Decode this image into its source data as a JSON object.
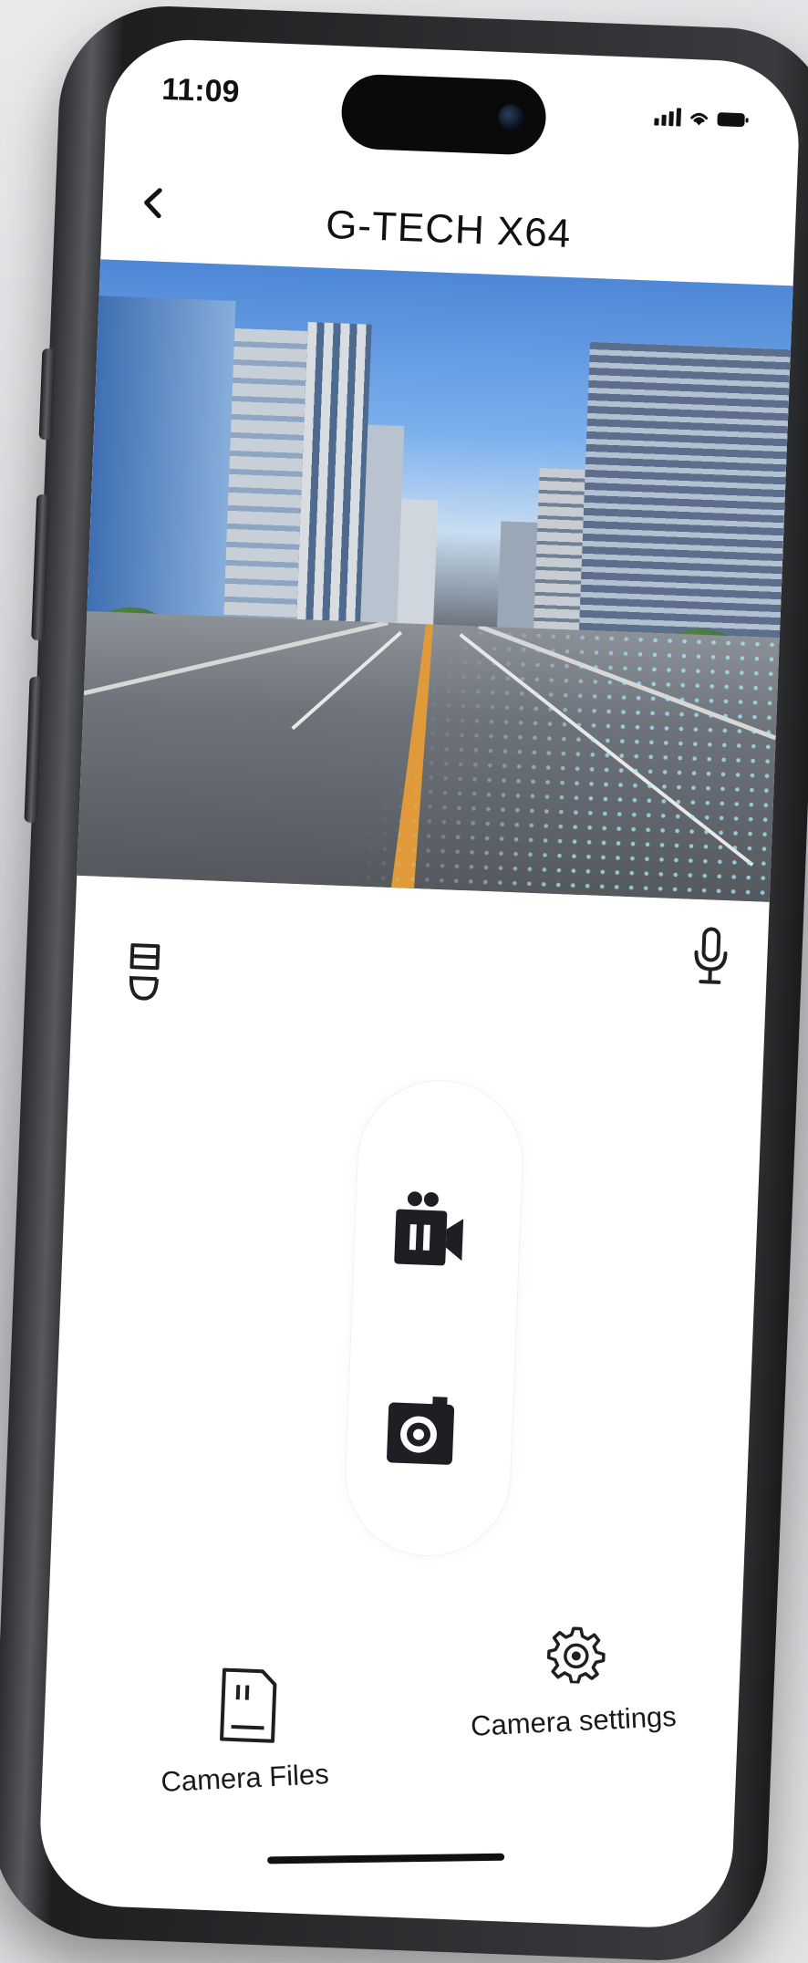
{
  "status_bar": {
    "time": "11:09"
  },
  "header": {
    "title": "G-TECH X64"
  },
  "controls": {
    "record_icon": "video-pause-icon",
    "snapshot_icon": "camera-icon",
    "mic_icon": "microphone-icon",
    "hd_icon": "hd-toggle-icon"
  },
  "bottom_nav": {
    "files_label": "Camera Files",
    "settings_label": "Camera settings"
  },
  "colors": {
    "icon": "#1e1f24",
    "background": "#ffffff"
  }
}
